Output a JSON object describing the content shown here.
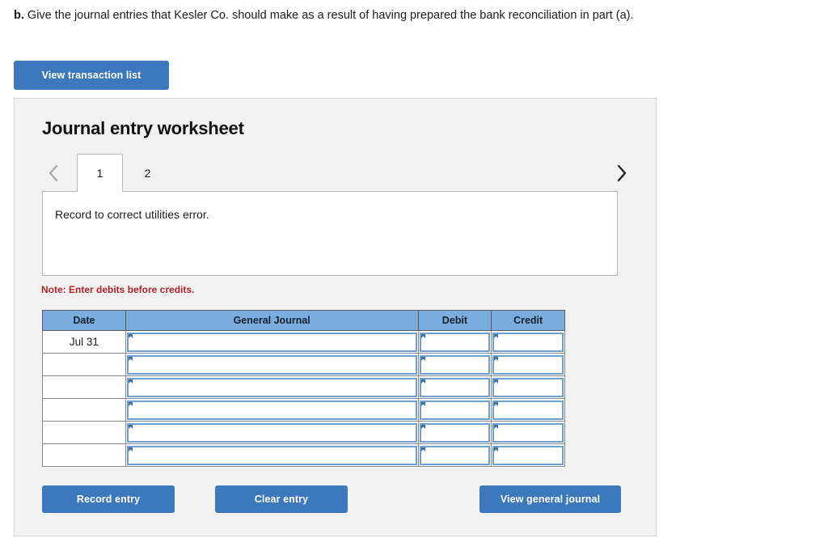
{
  "question": {
    "label": "b.",
    "text": "Give the journal entries that Kesler Co. should make as a result of having prepared the bank reconciliation in part (a)."
  },
  "toolbar": {
    "view_transaction_list_label": "View transaction list"
  },
  "worksheet": {
    "title": "Journal entry worksheet",
    "tabs": [
      {
        "label": "1",
        "active": true
      },
      {
        "label": "2",
        "active": false
      }
    ],
    "prev_icon": "chevron-left-icon",
    "next_icon": "chevron-right-icon",
    "description": "Record to correct utilities error.",
    "note": "Note: Enter debits before credits.",
    "table": {
      "headers": [
        "Date",
        "General Journal",
        "Debit",
        "Credit"
      ],
      "rows": [
        {
          "date": "Jul 31",
          "general_journal": "",
          "debit": "",
          "credit": ""
        },
        {
          "date": "",
          "general_journal": "",
          "debit": "",
          "credit": ""
        },
        {
          "date": "",
          "general_journal": "",
          "debit": "",
          "credit": ""
        },
        {
          "date": "",
          "general_journal": "",
          "debit": "",
          "credit": ""
        },
        {
          "date": "",
          "general_journal": "",
          "debit": "",
          "credit": ""
        },
        {
          "date": "",
          "general_journal": "",
          "debit": "",
          "credit": ""
        }
      ]
    },
    "actions": {
      "record_entry_label": "Record entry",
      "clear_entry_label": "Clear entry",
      "view_general_journal_label": "View general journal"
    }
  },
  "colors": {
    "button_blue": "#3c78bc",
    "header_blue": "#7badde",
    "panel_gray": "#f2f2f2",
    "note_red": "#b4232c",
    "cell_border_blue": "#6f9fd0"
  }
}
